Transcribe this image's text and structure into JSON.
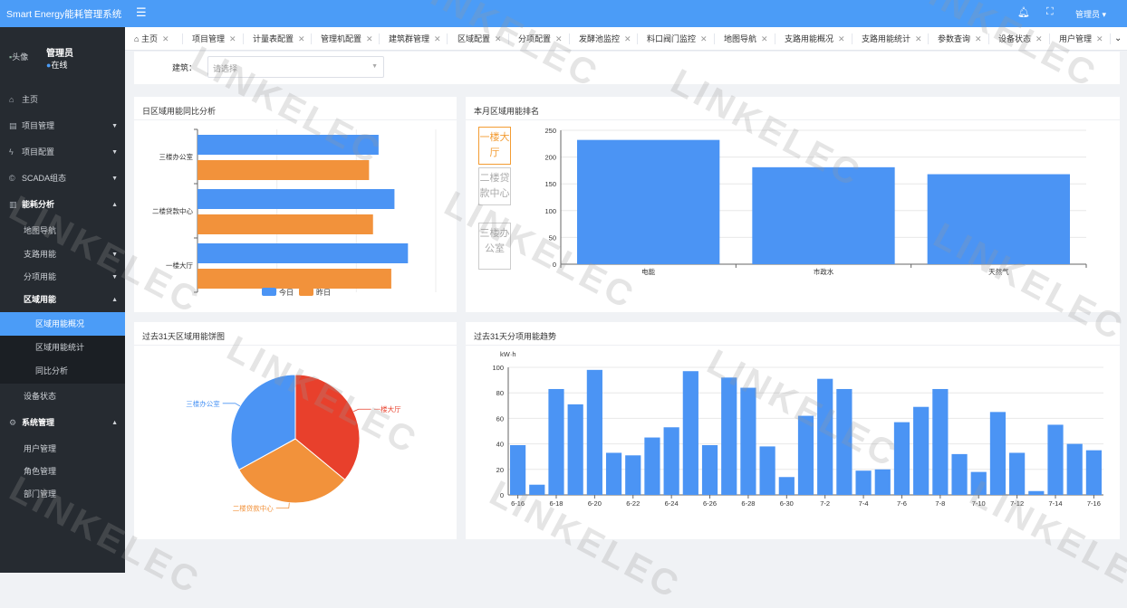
{
  "header": {
    "app_title": "Smart Energy能耗管理系统",
    "user": "管理员"
  },
  "sidebar": {
    "avatar_alt": "头像",
    "user_name": "管理员",
    "status": "在线",
    "items": [
      {
        "label": "主页",
        "icon": "home-icon"
      },
      {
        "label": "项目管理",
        "icon": "building-icon"
      },
      {
        "label": "项目配置",
        "icon": "bolt-icon"
      },
      {
        "label": "SCADA组态",
        "icon": "copyright-icon"
      },
      {
        "label": "能耗分析",
        "icon": "bar-chart-icon"
      },
      {
        "label": "地图导航"
      },
      {
        "label": "支路用能"
      },
      {
        "label": "分项用能"
      },
      {
        "label": "区域用能"
      },
      {
        "label": "区域用能概况"
      },
      {
        "label": "区域用能统计"
      },
      {
        "label": "同比分析"
      },
      {
        "label": "设备状态"
      },
      {
        "label": "系统管理",
        "icon": "gear-icon"
      },
      {
        "label": "用户管理"
      },
      {
        "label": "角色管理"
      },
      {
        "label": "部门管理"
      }
    ]
  },
  "tabs": [
    "主页",
    "项目管理",
    "计量表配置",
    "管理机配置",
    "建筑群管理",
    "区域配置",
    "分项配置",
    "发酵池监控",
    "料口阀门监控",
    "地图导航",
    "支路用能概况",
    "支路用能统计",
    "参数查询",
    "设备状态",
    "用户管理"
  ],
  "filter": {
    "label": "建筑：",
    "placeholder": "请选择"
  },
  "watermark": "LINKELEC",
  "cards": {
    "daily_title": "日区域用能同比分析",
    "rank_title": "本月区域用能排名",
    "pie_title": "过去31天区域用能饼图",
    "trend_title": "过去31天分项用能趋势"
  },
  "rank_buttons": [
    "一楼大厅",
    "二楼贷款中心",
    "三楼办公室"
  ],
  "chart_data": [
    {
      "type": "bar",
      "orientation": "horizontal",
      "categories": [
        "三楼办公室",
        "二楼贷款中心",
        "一楼大厅"
      ],
      "series": [
        {
          "name": "今日",
          "values": [
            228,
            248,
            265
          ],
          "color": "#4b94f4"
        },
        {
          "name": "昨日",
          "values": [
            216,
            221,
            244
          ],
          "color": "#f2923b"
        }
      ],
      "legend": "bottom"
    },
    {
      "type": "bar",
      "categories": [
        "电能",
        "市政水",
        "天然气"
      ],
      "values": [
        232,
        181,
        168
      ],
      "ylim": [
        0,
        250
      ],
      "yticks": [
        0,
        50,
        100,
        150,
        200,
        250
      ],
      "grid": true,
      "color": "#4b94f4"
    },
    {
      "type": "pie",
      "labels": [
        "一楼大厅",
        "二楼贷款中心",
        "三楼办公室"
      ],
      "values": [
        36,
        31,
        33
      ],
      "colors": [
        "#e8402c",
        "#f2923b",
        "#4b94f4"
      ]
    },
    {
      "type": "bar",
      "ylabel": "kW·h",
      "ylim": [
        0,
        100
      ],
      "yticks": [
        0,
        20,
        40,
        60,
        80,
        100
      ],
      "grid": true,
      "color": "#4b94f4",
      "categories": [
        "6-16",
        "6-17",
        "6-18",
        "6-19",
        "6-20",
        "6-21",
        "6-22",
        "6-23",
        "6-24",
        "6-25",
        "6-26",
        "6-27",
        "6-28",
        "6-29",
        "6-30",
        "7-1",
        "7-2",
        "7-3",
        "7-4",
        "7-5",
        "7-6",
        "7-7",
        "7-8",
        "7-9",
        "7-10",
        "7-11",
        "7-12",
        "7-13",
        "7-14",
        "7-15",
        "7-16"
      ],
      "tick_labels": [
        "6-16",
        "6-18",
        "6-20",
        "6-22",
        "6-24",
        "6-26",
        "6-28",
        "6-30",
        "7-2",
        "7-4",
        "7-6",
        "7-8",
        "7-10",
        "7-12",
        "7-14",
        "7-16"
      ],
      "values": [
        39,
        8,
        83,
        71,
        98,
        33,
        31,
        45,
        53,
        97,
        39,
        92,
        84,
        38,
        14,
        62,
        91,
        83,
        19,
        20,
        57,
        69,
        83,
        32,
        18,
        65,
        33,
        3,
        55,
        40,
        35
      ]
    }
  ]
}
